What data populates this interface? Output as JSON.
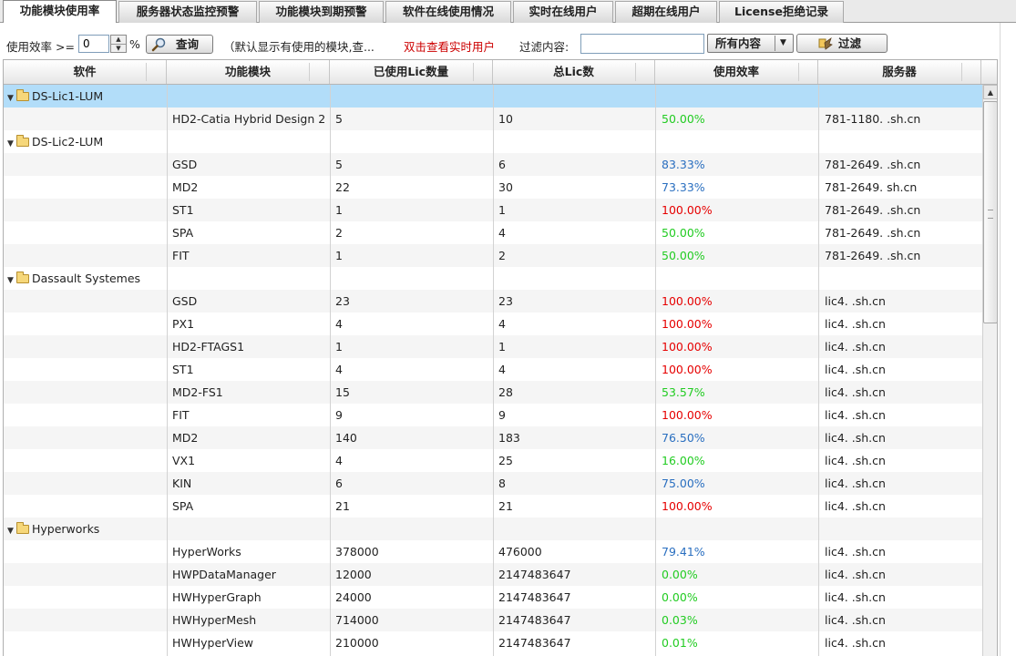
{
  "tabs": [
    {
      "label": "功能模块使用率",
      "active": true
    },
    {
      "label": "服务器状态监控预警",
      "active": false
    },
    {
      "label": "功能模块到期预警",
      "active": false
    },
    {
      "label": "软件在线使用情况",
      "active": false
    },
    {
      "label": "实时在线用户",
      "active": false
    },
    {
      "label": "超期在线用户",
      "active": false
    },
    {
      "label": "License拒绝记录",
      "active": false
    }
  ],
  "toolbar": {
    "efficiency_label": "使用效率 >=",
    "efficiency_value": "0",
    "percent_sign": "%",
    "query_button": "查询",
    "default_hint": "（默认显示有使用的模块,查...",
    "dblclick_hint": "双击查看实时用户",
    "filter_label": "过滤内容:",
    "filter_value": "",
    "scope_select": "所有内容",
    "filter_button": "过滤"
  },
  "colors": {
    "selected_row": "#b2ddf9",
    "efficiency_red": "#e60000",
    "efficiency_green": "#22cc22",
    "efficiency_blue": "#2a6fc0",
    "hint_red": "#cc0000"
  },
  "icons": {
    "query": "search-icon",
    "filter": "filter-icon",
    "group": "folder-icon",
    "expand": "triangle-down-icon"
  },
  "grid": {
    "columns": [
      "软件",
      "功能模块",
      "已使用Lic数量",
      "总Lic数",
      "使用效率",
      "服务器"
    ],
    "rows": [
      {
        "type": "group",
        "label": "DS-Lic1-LUM",
        "selected": true
      },
      {
        "type": "item",
        "module": "HD2-Catia Hybrid Design 2",
        "used": "5",
        "total": "10",
        "eff": "50.00%",
        "effColor": "green",
        "server": "781-1180.   .sh.cn"
      },
      {
        "type": "group",
        "label": "DS-Lic2-LUM"
      },
      {
        "type": "item",
        "module": "GSD",
        "used": "5",
        "total": "6",
        "eff": "83.33%",
        "effColor": "blue",
        "server": "781-2649.   .sh.cn"
      },
      {
        "type": "item",
        "module": "MD2",
        "used": "22",
        "total": "30",
        "eff": "73.33%",
        "effColor": "blue",
        "server": "781-2649.   sh.cn"
      },
      {
        "type": "item",
        "module": "ST1",
        "used": "1",
        "total": "1",
        "eff": "100.00%",
        "effColor": "red",
        "server": "781-2649.   .sh.cn"
      },
      {
        "type": "item",
        "module": "SPA",
        "used": "2",
        "total": "4",
        "eff": "50.00%",
        "effColor": "green",
        "server": "781-2649.   .sh.cn"
      },
      {
        "type": "item",
        "module": "FIT",
        "used": "1",
        "total": "2",
        "eff": "50.00%",
        "effColor": "green",
        "server": "781-2649.   .sh.cn"
      },
      {
        "type": "group",
        "label": "Dassault Systemes"
      },
      {
        "type": "item",
        "module": "GSD",
        "used": "23",
        "total": "23",
        "eff": "100.00%",
        "effColor": "red",
        "server": "lic4.   .sh.cn"
      },
      {
        "type": "item",
        "module": "PX1",
        "used": "4",
        "total": "4",
        "eff": "100.00%",
        "effColor": "red",
        "server": "lic4.   .sh.cn"
      },
      {
        "type": "item",
        "module": "HD2-FTAGS1",
        "used": "1",
        "total": "1",
        "eff": "100.00%",
        "effColor": "red",
        "server": "lic4.   .sh.cn"
      },
      {
        "type": "item",
        "module": "ST1",
        "used": "4",
        "total": "4",
        "eff": "100.00%",
        "effColor": "red",
        "server": "lic4.   .sh.cn"
      },
      {
        "type": "item",
        "module": "MD2-FS1",
        "used": "15",
        "total": "28",
        "eff": "53.57%",
        "effColor": "green",
        "server": "lic4.   .sh.cn"
      },
      {
        "type": "item",
        "module": "FIT",
        "used": "9",
        "total": "9",
        "eff": "100.00%",
        "effColor": "red",
        "server": "lic4.   .sh.cn"
      },
      {
        "type": "item",
        "module": "MD2",
        "used": "140",
        "total": "183",
        "eff": "76.50%",
        "effColor": "blue",
        "server": "lic4.   .sh.cn"
      },
      {
        "type": "item",
        "module": "VX1",
        "used": "4",
        "total": "25",
        "eff": "16.00%",
        "effColor": "green",
        "server": "lic4.   .sh.cn"
      },
      {
        "type": "item",
        "module": "KIN",
        "used": "6",
        "total": "8",
        "eff": "75.00%",
        "effColor": "blue",
        "server": "lic4.   .sh.cn"
      },
      {
        "type": "item",
        "module": "SPA",
        "used": "21",
        "total": "21",
        "eff": "100.00%",
        "effColor": "red",
        "server": "lic4.   .sh.cn"
      },
      {
        "type": "group",
        "label": "Hyperworks"
      },
      {
        "type": "item",
        "module": "HyperWorks",
        "used": "378000",
        "total": "476000",
        "eff": "79.41%",
        "effColor": "blue",
        "server": "lic4.   .sh.cn"
      },
      {
        "type": "item",
        "module": "HWPDataManager",
        "used": "12000",
        "total": "2147483647",
        "eff": "0.00%",
        "effColor": "green",
        "server": "lic4.   .sh.cn"
      },
      {
        "type": "item",
        "module": "HWHyperGraph",
        "used": "24000",
        "total": "2147483647",
        "eff": "0.00%",
        "effColor": "green",
        "server": "lic4.   .sh.cn"
      },
      {
        "type": "item",
        "module": "HWHyperMesh",
        "used": "714000",
        "total": "2147483647",
        "eff": "0.03%",
        "effColor": "green",
        "server": "lic4.   .sh.cn"
      },
      {
        "type": "item",
        "module": "HWHyperView",
        "used": "210000",
        "total": "2147483647",
        "eff": "0.01%",
        "effColor": "green",
        "server": "lic4.   .sh.cn"
      }
    ]
  }
}
